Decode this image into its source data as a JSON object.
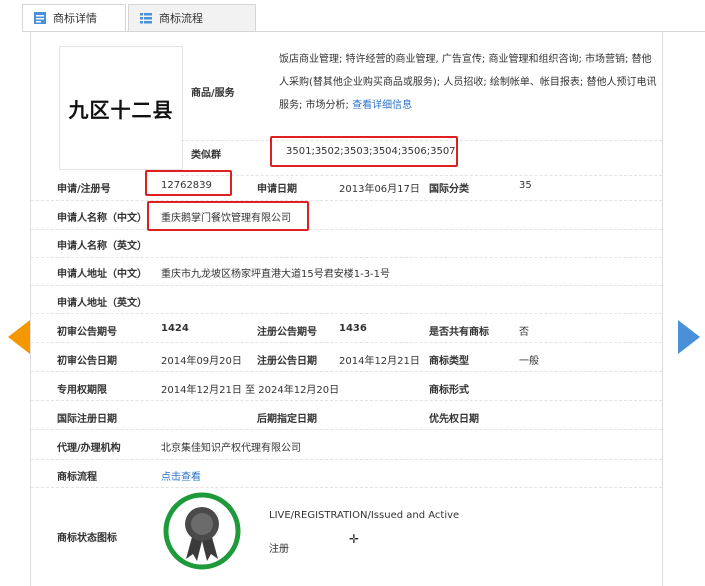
{
  "tabs": [
    {
      "label": "商标详情",
      "icon": "document-icon",
      "active": true
    },
    {
      "label": "商标流程",
      "icon": "list-icon",
      "active": false
    }
  ],
  "logo_text": "九区十二县",
  "goods": {
    "label": "商品/服务",
    "text": "饭店商业管理; 特许经营的商业管理, 广告宣传; 商业管理和组织咨询; 市场营销; 替他人采购(替其他企业购买商品或服务); 人员招收; 绘制帐单、帐目报表; 替他人预订电讯服务; 市场分析;",
    "link": "查看详细信息"
  },
  "similar_group": {
    "label": "类似群",
    "value": "3501;3502;3503;3504;3506;3507;"
  },
  "reg_number": {
    "label": "申请/注册号",
    "value": "12762839"
  },
  "apply_date": {
    "label": "申请日期",
    "value": "2013年06月17日"
  },
  "intl_class": {
    "label": "国际分类",
    "value": "35"
  },
  "applicant_cn": {
    "label": "申请人名称（中文）",
    "value": "重庆鹅掌门餐饮管理有限公司"
  },
  "applicant_en": {
    "label": "申请人名称（英文）",
    "value": ""
  },
  "address_cn": {
    "label": "申请人地址（中文）",
    "value": "重庆市九龙坡区杨家坪直港大道15号君安楼1-3-1号"
  },
  "address_en": {
    "label": "申请人地址（英文）",
    "value": ""
  },
  "prelim_issue": {
    "label": "初审公告期号",
    "value": "1424"
  },
  "reg_issue": {
    "label": "注册公告期号",
    "value": "1436"
  },
  "shared": {
    "label": "是否共有商标",
    "value": "否"
  },
  "prelim_date": {
    "label": "初审公告日期",
    "value": "2014年09月20日"
  },
  "reg_date": {
    "label": "注册公告日期",
    "value": "2014年12月21日"
  },
  "tm_type": {
    "label": "商标类型",
    "value": "一般"
  },
  "exclusive_period": {
    "label": "专用权期限",
    "value": "2014年12月21日 至 2024年12月20日"
  },
  "tm_form": {
    "label": "商标形式",
    "value": ""
  },
  "intl_reg_date": {
    "label": "国际注册日期",
    "value": ""
  },
  "later_date": {
    "label": "后期指定日期",
    "value": ""
  },
  "priority_date": {
    "label": "优先权日期",
    "value": ""
  },
  "agent": {
    "label": "代理/办理机构",
    "value": "北京集佳知识产权代理有限公司"
  },
  "process": {
    "label": "商标流程",
    "link": "点击查看"
  },
  "status": {
    "label": "商标状态图标",
    "en": "LIVE/REGISTRATION/Issued and Active",
    "cn": "注册"
  },
  "colors": {
    "red_highlight": "#e02020",
    "link": "#2b72c7",
    "arrow_left": "#f39800",
    "arrow_right": "#4a90d9",
    "seal_ring": "#1e9a3a"
  }
}
